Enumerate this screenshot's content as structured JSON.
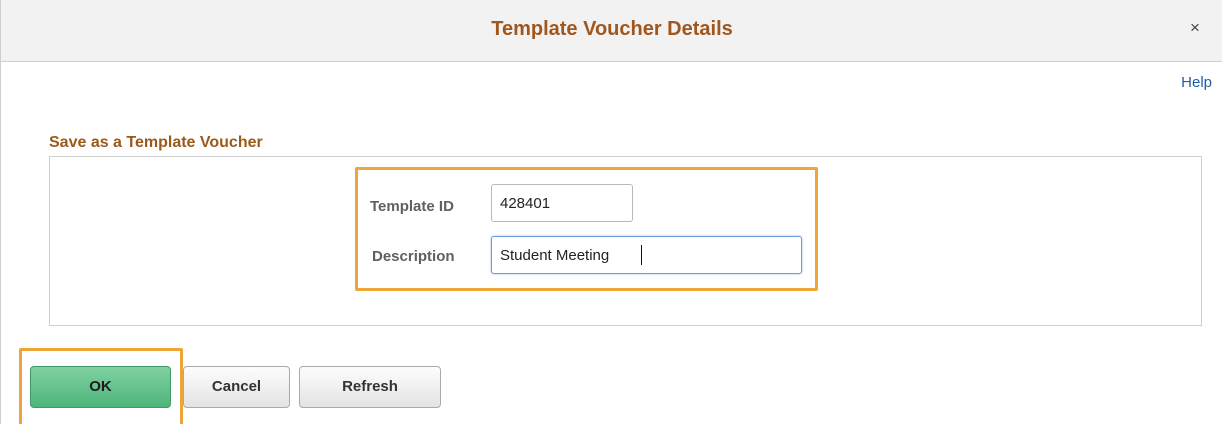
{
  "dialog": {
    "title": "Template Voucher Details",
    "close_symbol": "×",
    "help_label": "Help"
  },
  "section": {
    "title": "Save as a Template Voucher"
  },
  "fields": {
    "template_id": {
      "label": "Template ID",
      "value": "428401"
    },
    "description": {
      "label": "Description",
      "value": "Student Meeting"
    }
  },
  "buttons": {
    "ok_label": "OK",
    "cancel_label": "Cancel",
    "refresh_label": "Refresh"
  },
  "colors": {
    "title": "#a0571e",
    "section_title": "#9a5a1c",
    "highlight": "#f0a53a",
    "ok_button": "#5cbf86",
    "link": "#1f5fa8"
  },
  "icons": {
    "close": "close-icon",
    "text_caret": "text-caret-icon"
  }
}
